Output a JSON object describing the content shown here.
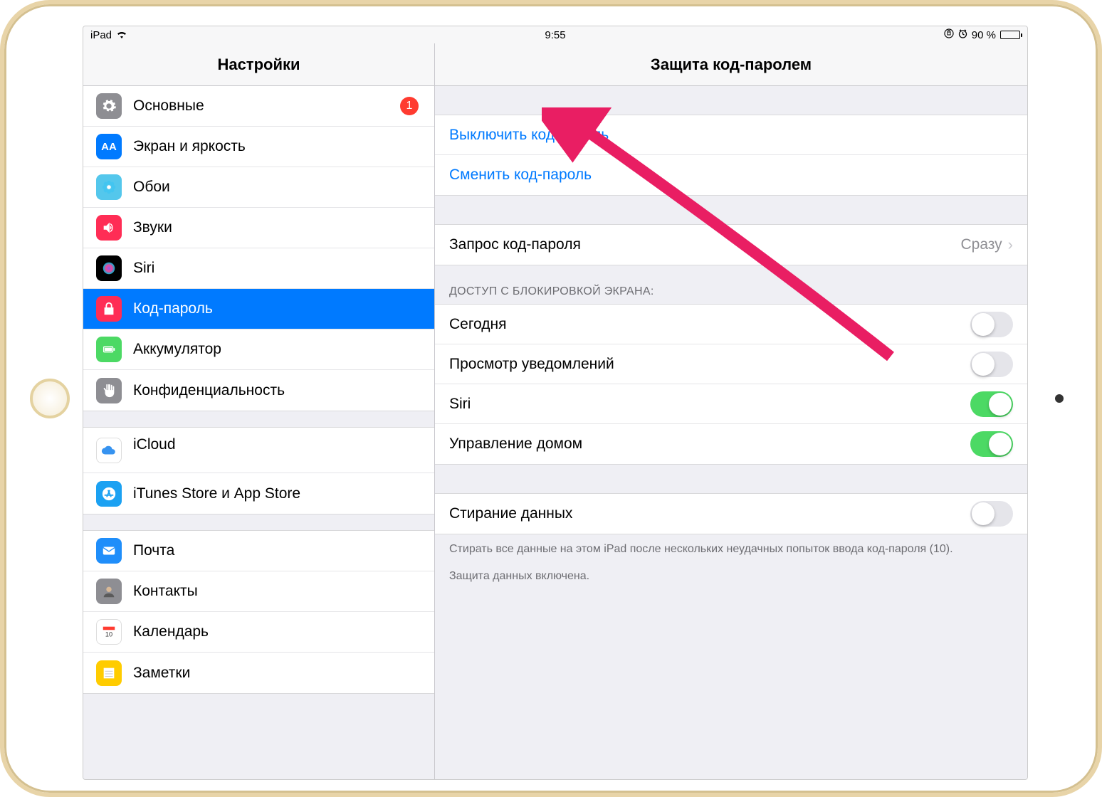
{
  "status": {
    "carrier": "iPad",
    "time": "9:55",
    "battery_pct": "90 %"
  },
  "sidebar": {
    "title": "Настройки",
    "groups": [
      {
        "items": [
          {
            "id": "general",
            "label": "Основные",
            "badge": "1",
            "icon_bg": "#8e8e93",
            "icon": "gear"
          },
          {
            "id": "display",
            "label": "Экран и яркость",
            "icon_bg": "#007aff",
            "icon": "AA"
          },
          {
            "id": "wallpaper",
            "label": "Обои",
            "icon_bg": "#54c7ec",
            "icon": "flower"
          },
          {
            "id": "sounds",
            "label": "Звуки",
            "icon_bg": "#ff2d55",
            "icon": "speaker"
          },
          {
            "id": "siri",
            "label": "Siri",
            "icon_bg": "#000",
            "icon": "siri"
          },
          {
            "id": "passcode",
            "label": "Код-пароль",
            "selected": true,
            "icon_bg": "#ff2d55",
            "icon": "lock"
          },
          {
            "id": "battery",
            "label": "Аккумулятор",
            "icon_bg": "#4cd964",
            "icon": "battery"
          },
          {
            "id": "privacy",
            "label": "Конфиденциальность",
            "icon_bg": "#8e8e93",
            "icon": "hand"
          }
        ]
      },
      {
        "items": [
          {
            "id": "icloud",
            "label": "iCloud",
            "sub": " ",
            "icon_bg": "#fff",
            "icon": "cloud"
          },
          {
            "id": "itunes",
            "label": "iTunes Store и App Store",
            "icon_bg": "#1ba1f2",
            "icon": "appstore"
          }
        ]
      },
      {
        "items": [
          {
            "id": "mail",
            "label": "Почта",
            "icon_bg": "#1f8efa",
            "icon": "mail"
          },
          {
            "id": "contacts",
            "label": "Контакты",
            "icon_bg": "#8e8e93",
            "icon": "contacts"
          },
          {
            "id": "calendar",
            "label": "Календарь",
            "icon_bg": "#fff",
            "icon": "calendar"
          },
          {
            "id": "notes",
            "label": "Заметки",
            "icon_bg": "#ffcc00",
            "icon": "notes"
          }
        ]
      }
    ]
  },
  "detail": {
    "title": "Защита код-паролем",
    "group1": {
      "turn_off": "Выключить код-пароль",
      "change": "Сменить код-пароль"
    },
    "group2": {
      "require_label": "Запрос код-пароля",
      "require_value": "Сразу"
    },
    "lock_header": "ДОСТУП С БЛОКИРОВКОЙ ЭКРАНА:",
    "toggles": [
      {
        "label": "Сегодня",
        "on": false
      },
      {
        "label": "Просмотр уведомлений",
        "on": false
      },
      {
        "label": "Siri",
        "on": true
      },
      {
        "label": "Управление домом",
        "on": true
      }
    ],
    "erase": {
      "label": "Стирание данных",
      "on": false
    },
    "footer1": "Стирать все данные на этом iPad после нескольких неудачных попыток ввода код-пароля (10).",
    "footer2": "Защита данных включена."
  }
}
